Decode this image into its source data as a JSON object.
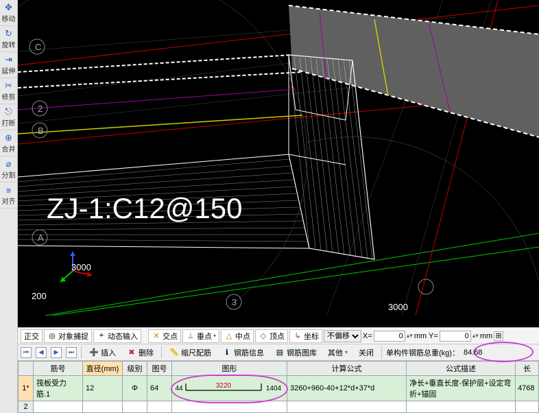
{
  "left_tools": [
    {
      "label": "移动",
      "icon": "✥"
    },
    {
      "label": "旋转",
      "icon": "↻"
    },
    {
      "label": "延伸",
      "icon": "⇥"
    },
    {
      "label": "修剪",
      "icon": "✂"
    },
    {
      "label": "打断",
      "icon": "⎋"
    },
    {
      "label": "合并",
      "icon": "⊕"
    },
    {
      "label": "分割",
      "icon": "⌀"
    },
    {
      "label": "对齐",
      "icon": "≡"
    }
  ],
  "viewport": {
    "big_label": "ZJ-1:C12@150",
    "coord1": "3000",
    "coord2": "200",
    "coord3": "3000",
    "axis_B": "B",
    "axis_C": "C",
    "axis_2": "2",
    "axis_3": "3",
    "axis_A": "A"
  },
  "status": {
    "ortho": "正交",
    "osnap": "对象捕捉",
    "dyn": "动态输入",
    "intersect": "交点",
    "perp": "垂点",
    "mid": "中点",
    "apex": "顶点",
    "coord": "坐标",
    "offset_options": [
      "不偏移"
    ],
    "x_label": "X=",
    "x_val": "0",
    "y_label": "mm Y=",
    "y_val": "0",
    "unit_tail": "mm"
  },
  "toolbar2": {
    "insert": "插入",
    "delete": "删除",
    "scale": "缩尺配筋",
    "info": "钢筋信息",
    "lib": "钢筋图库",
    "other": "其他",
    "close": "关闭",
    "weight_label": "单构件钢筋总重(kg)：",
    "weight_value": "84.68"
  },
  "table": {
    "headers": {
      "rownum": "",
      "name": "筋号",
      "diameter": "直径(mm)",
      "grade": "级别",
      "figno": "图号",
      "shape": "图形",
      "formula": "计算公式",
      "desc": "公式描述",
      "length": "长"
    },
    "row1": {
      "num": "1*",
      "name": "筏板受力筋.1",
      "diameter": "12",
      "grade": "Φ",
      "figno": "64",
      "shape_left": "44",
      "shape_mid": "3220",
      "shape_right": "1404",
      "formula": "3260+960-40+12*d+37*d",
      "desc": "净长+垂直长度-保护层+设定弯折+锚固",
      "length": "4768"
    },
    "row2": {
      "num": "2"
    }
  }
}
